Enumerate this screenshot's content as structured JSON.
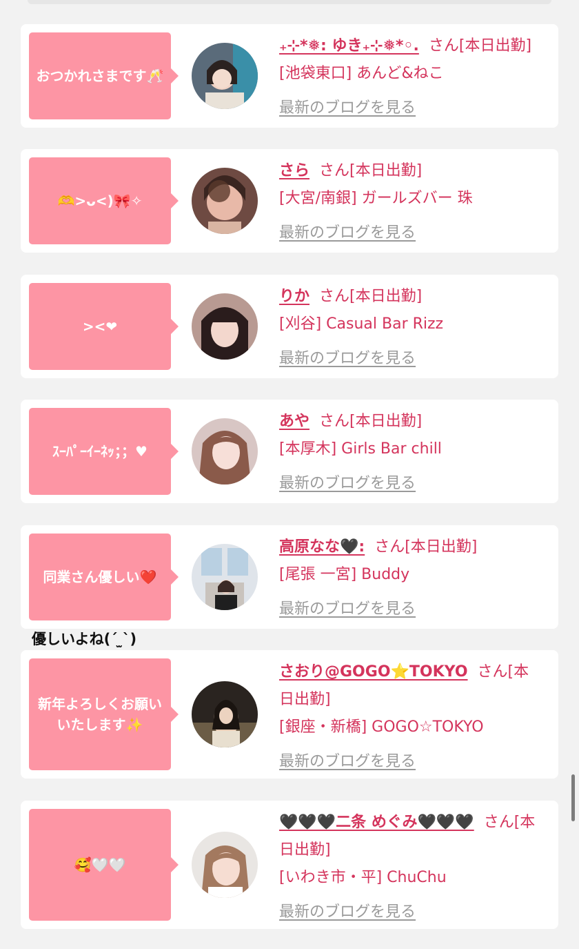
{
  "common": {
    "blog_link": "最新のブログを見る"
  },
  "cards": [
    {
      "message": "おつかれさまです🥂",
      "name": "₊⊹*❅: ゆき₊⊹❅*◦.",
      "honorific": "さん[本日出勤]",
      "shop": "[池袋東口] あんど&ねこ"
    },
    {
      "message": "🫶>ᴗ<)🎀✧",
      "name": "さら",
      "honorific": "さん[本日出勤]",
      "shop": "[大宮/南銀] ガールズバー 珠"
    },
    {
      "message": "><❤",
      "name": "りか",
      "honorific": "さん[本日出勤]",
      "shop": "[刈谷] Casual Bar Rizz"
    },
    {
      "message": "ｽｰﾊﾟｰｲｰﾈｯ；；♥",
      "name": "あや",
      "honorific": "さん[本日出勤]",
      "shop": "[本厚木] Girls Bar chill"
    },
    {
      "message": "同業さん優しい❤️",
      "name": "高原なな🖤:",
      "honorific": "さん[本日出勤]",
      "shop": "[尾張 一宮] Buddy"
    },
    {
      "message": "新年よろしくお願いいたします✨",
      "name": "さおり@GOGO⭐TOKYO",
      "honorific": "さん[本日出勤]",
      "shop": "[銀座・新橋] GOGO☆TOKYO"
    },
    {
      "message": "🥰🤍🤍",
      "name": "🖤🖤🖤二条 めぐみ🖤🖤🖤",
      "honorific": "さん[本日出勤]",
      "shop": "[いわき市・平] ChuChu"
    }
  ],
  "overflow_caption": "優しいよね(ˊ ̫ˋ)"
}
